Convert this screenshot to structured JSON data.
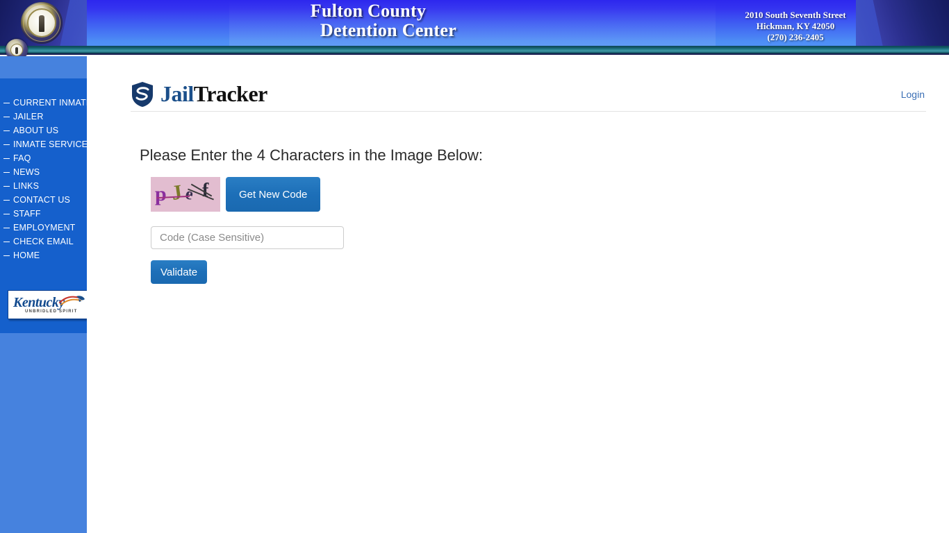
{
  "banner": {
    "title_line1": "Fulton County",
    "title_line2": "Detention Center",
    "address_line1": "2010 South Seventh Street",
    "address_line2": "Hickman, KY 42050",
    "address_line3": "(270) 236-2405",
    "seal_name": "kentucky-state-seal"
  },
  "tab": {
    "current_inmates_label": "Current Inmates"
  },
  "sidebar": {
    "items": [
      {
        "label": "CURRENT INMATES"
      },
      {
        "label": "JAILER"
      },
      {
        "label": "ABOUT US"
      },
      {
        "label": "INMATE SERVICES"
      },
      {
        "label": "FAQ"
      },
      {
        "label": "NEWS"
      },
      {
        "label": "LINKS"
      },
      {
        "label": "CONTACT US"
      },
      {
        "label": "STAFF"
      },
      {
        "label": "EMPLOYMENT"
      },
      {
        "label": "CHECK EMAIL"
      },
      {
        "label": "HOME"
      }
    ],
    "kentucky_logo": {
      "word": "Kentucky",
      "tagline": "UNBRIDLED SPIRIT"
    }
  },
  "app_header": {
    "logo_part1": "Jail",
    "logo_part2": "Tracker",
    "login_label": "Login"
  },
  "main": {
    "prompt": "Please Enter the 4 Characters in the Image Below:",
    "captcha": {
      "characters": [
        {
          "ch": "p",
          "color": "#8a2f9e"
        },
        {
          "ch": "J",
          "color": "#7c7a2a"
        },
        {
          "ch": "e",
          "color": "#3a3050"
        },
        {
          "ch": "f",
          "color": "#2c2c3a"
        }
      ],
      "background": "#e2bdd0"
    },
    "get_new_code_label": "Get New Code",
    "code_placeholder": "Code (Case Sensitive)",
    "code_value": "",
    "validate_label": "Validate"
  },
  "colors": {
    "banner_top": "#2d27ee",
    "banner_bottom": "#4f92f6",
    "teal_bar": "#2e8795",
    "nav_panel": "#1560cc",
    "left_column": "#4682de",
    "button_blue": "#1d6fb8",
    "link_blue": "#3b6fb5"
  }
}
